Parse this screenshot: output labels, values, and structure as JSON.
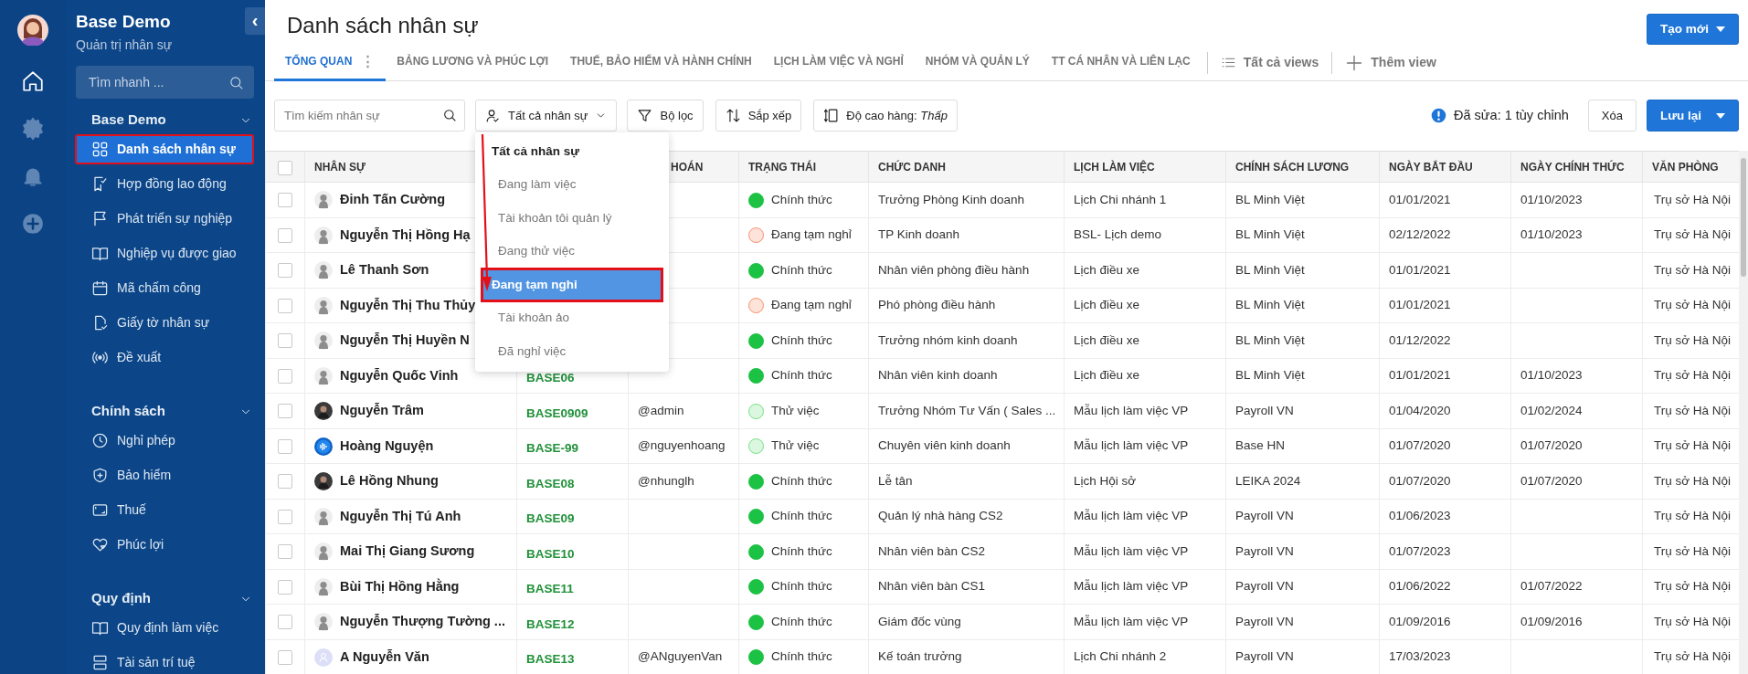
{
  "rail": {
    "items": [
      {
        "kind": "home",
        "selected": true
      },
      {
        "kind": "settings",
        "selected": false
      },
      {
        "kind": "bell",
        "selected": false
      },
      {
        "kind": "add",
        "selected": false
      }
    ]
  },
  "sidebar": {
    "collapse_icon": "‹",
    "title": "Base Demo",
    "subtitle": "Quản trị nhân sự",
    "search": {
      "placeholder": "Tìm nhanh ..."
    },
    "groups": [
      {
        "title": "Base Demo",
        "expanded": true,
        "items": [
          {
            "label": "Danh sách nhân sự",
            "selected": true
          },
          {
            "label": "Hợp đồng lao động",
            "selected": false
          },
          {
            "label": "Phát triển sự nghiệp",
            "selected": false
          },
          {
            "label": "Nghiệp vụ được giao",
            "selected": false
          },
          {
            "label": "Mã chấm công",
            "selected": false
          },
          {
            "label": "Giấy tờ nhân sự",
            "selected": false
          },
          {
            "label": "Đề xuất",
            "selected": false
          }
        ]
      },
      {
        "title": "Chính sách",
        "expanded": true,
        "items": [
          {
            "label": "Nghỉ phép",
            "selected": false
          },
          {
            "label": "Bảo hiểm",
            "selected": false
          },
          {
            "label": "Thuế",
            "selected": false
          },
          {
            "label": "Phúc lợi",
            "selected": false
          }
        ]
      },
      {
        "title": "Quy định",
        "expanded": true,
        "items": [
          {
            "label": "Quy định làm việc",
            "selected": false
          },
          {
            "label": "Tài sản trí tuệ",
            "selected": false
          }
        ]
      }
    ]
  },
  "page": {
    "title": "Danh sách nhân sự",
    "create_button": "Tạo mới"
  },
  "tabs": [
    {
      "label": "TỔNG QUAN",
      "selected": true,
      "menu": "⋮"
    },
    {
      "label": "BẢNG LƯƠNG VÀ PHÚC LỢI",
      "selected": false
    },
    {
      "label": "THUẾ, BẢO HIỂM VÀ HÀNH CHÍNH",
      "selected": false
    },
    {
      "label": "LỊCH LÀM VIỆC VÀ NGHỈ",
      "selected": false
    },
    {
      "label": "NHÓM VÀ QUẢN LÝ",
      "selected": false
    },
    {
      "label": "TT CÁ NHÂN VÀ LIÊN LẠC",
      "selected": false
    }
  ],
  "view_links": [
    {
      "kind": "list",
      "label": "Tất cả views"
    },
    {
      "kind": "add",
      "label": "Thêm view"
    }
  ],
  "toolbar": {
    "search": {
      "placeholder": "Tìm kiếm nhân sự"
    },
    "filter_button": "Tất cả nhân sự",
    "buttons": [
      {
        "kind": "filter",
        "label": "Bộ lọc"
      },
      {
        "kind": "sort",
        "label": "Sắp xếp"
      },
      {
        "kind": "height",
        "label": "Độ cao hàng: *Thấp*"
      }
    ],
    "notice": "Đã sửa: 1 tùy chỉnh",
    "clear_button": "Xóa",
    "save_button": "Lưu lại"
  },
  "filter_menu": {
    "header": "Tất cả nhân sự",
    "items": [
      {
        "label": "Đang làm việc",
        "selected": false
      },
      {
        "label": "Tài khoản tôi quản lý",
        "selected": false
      },
      {
        "label": "Đang thử việc",
        "selected": false
      },
      {
        "label": "Đang tạm nghỉ",
        "selected": true
      },
      {
        "label": "Tài khoản ảo",
        "selected": false
      },
      {
        "label": "Đã nghỉ việc",
        "selected": false
      }
    ]
  },
  "table": {
    "select_all": {
      "checked": false
    },
    "columns": [
      {
        "label": "NHÂN SỰ"
      },
      {},
      {
        "label": "HOÁN"
      },
      {
        "label": "TRẠNG THÁI"
      },
      {
        "label": "CHỨC DANH"
      },
      {
        "label": "LỊCH LÀM VIỆC"
      },
      {
        "label": "CHÍNH SÁCH LƯƠNG"
      },
      {
        "label": "NGÀY BẮT ĐẦU"
      },
      {
        "label": "NGÀY CHÍNH THỨC"
      },
      {
        "label": "VĂN PHÒNG"
      }
    ],
    "rows": [
      {
        "checked": false,
        "name": "Đinh Tấn Cường",
        "status": {
          "label": "Chính thức",
          "color": "#1cc244"
        },
        "title": "Trưởng Phòng Kinh doanh",
        "schedule": "Lịch Chi nhánh 1",
        "salary": "BL Minh Việt",
        "start": "01/01/2021",
        "official": "01/10/2023",
        "office": "Trụ sở Hà Nội"
      },
      {
        "checked": false,
        "name": "Nguyễn Thị Hồng Hạ",
        "status": {
          "label": "Đang tạm nghỉ",
          "color": "#fde3da"
        },
        "title": "TP Kinh doanh",
        "schedule": "BSL- Lịch demo",
        "salary": "BL Minh Việt",
        "start": "02/12/2022",
        "official": "01/10/2023",
        "office": "Trụ sở Hà Nội"
      },
      {
        "checked": false,
        "name": "Lê Thanh Sơn",
        "status": {
          "label": "Chính thức",
          "color": "#1cc244"
        },
        "title": "Nhân viên phòng điều hành",
        "schedule": "Lịch điều xe",
        "salary": "BL Minh Việt",
        "start": "01/01/2021",
        "office": "Trụ sở Hà Nội"
      },
      {
        "checked": false,
        "name": "Nguyễn Thị Thu Thủy",
        "status": {
          "label": "Đang tạm nghỉ",
          "color": "#fde3da"
        },
        "title": "Phó phòng điều hành",
        "schedule": "Lịch điều xe",
        "salary": "BL Minh Việt",
        "start": "01/01/2021",
        "office": "Trụ sở Hà Nội"
      },
      {
        "checked": false,
        "name": "Nguyễn Thị Huyền N",
        "status": {
          "label": "Chính thức",
          "color": "#1cc244"
        },
        "title": "Trưởng nhóm kinh doanh",
        "schedule": "Lịch điều xe",
        "salary": "BL Minh Việt",
        "start": "01/12/2022",
        "office": "Trụ sở Hà Nội"
      },
      {
        "checked": false,
        "name": "Nguyễn Quốc Vinh",
        "code": "BASE06",
        "status": {
          "label": "Chính thức",
          "color": "#1cc244"
        },
        "title": "Nhân viên kinh doanh",
        "schedule": "Lịch điều xe",
        "salary": "BL Minh Việt",
        "start": "01/01/2021",
        "official": "01/10/2023",
        "office": "Trụ sở Hà Nội"
      },
      {
        "checked": false,
        "name": "Nguyễn Trâm",
        "code": "BASE0909",
        "account": "@admin",
        "status": {
          "label": "Thử việc",
          "color": "#dcf7e0"
        },
        "title": "Trưởng Nhóm Tư Vấn ( Sales ...",
        "schedule": "Mẫu lịch làm việc VP",
        "salary": "Payroll VN",
        "start": "01/04/2020",
        "official": "01/02/2024",
        "office": "Trụ sở Hà Nội"
      },
      {
        "checked": false,
        "name": "Hoàng Nguyện",
        "code": "BASE-99",
        "account": "@nguyenhoang",
        "status": {
          "label": "Thử việc",
          "color": "#dcf7e0"
        },
        "title": "Chuyên viên kinh doanh",
        "schedule": "Mẫu lịch làm việc VP",
        "salary": "Base HN",
        "start": "01/07/2020",
        "official": "01/07/2020",
        "office": "Trụ sở Hà Nội"
      },
      {
        "checked": false,
        "name": "Lê Hồng Nhung",
        "code": "BASE08",
        "account": "@nhunglh",
        "status": {
          "label": "Chính thức",
          "color": "#1cc244"
        },
        "title": "Lễ tân",
        "schedule": "Lịch Hội sở",
        "salary": "LEIKA 2024",
        "start": "01/07/2020",
        "official": "01/07/2020",
        "office": "Trụ sở Hà Nội"
      },
      {
        "checked": false,
        "name": "Nguyễn Thị Tú Anh",
        "code": "BASE09",
        "status": {
          "label": "Chính thức",
          "color": "#1cc244"
        },
        "title": "Quản lý nhà hàng CS2",
        "schedule": "Mẫu lịch làm việc VP",
        "salary": "Payroll VN",
        "start": "01/06/2023",
        "office": "Trụ sở Hà Nội"
      },
      {
        "checked": false,
        "name": "Mai Thị Giang Sương",
        "code": "BASE10",
        "status": {
          "label": "Chính thức",
          "color": "#1cc244"
        },
        "title": "Nhân viên bàn CS2",
        "schedule": "Mẫu lịch làm việc VP",
        "salary": "Payroll VN",
        "start": "01/07/2023",
        "office": "Trụ sở Hà Nội"
      },
      {
        "checked": false,
        "name": "Bùi Thị Hồng Hằng",
        "code": "BASE11",
        "status": {
          "label": "Chính thức",
          "color": "#1cc244"
        },
        "title": "Nhân viên bàn CS1",
        "schedule": "Mẫu lịch làm việc VP",
        "salary": "Payroll VN",
        "start": "01/06/2022",
        "official": "01/07/2022",
        "office": "Trụ sở Hà Nội"
      },
      {
        "checked": false,
        "name": "Nguyễn Thượng Tường ...",
        "code": "BASE12",
        "status": {
          "label": "Chính thức",
          "color": "#1cc244"
        },
        "title": "Giám đốc vùng",
        "schedule": "Mẫu lịch làm việc VP",
        "salary": "Payroll VN",
        "start": "01/09/2016",
        "official": "01/09/2016",
        "office": "Trụ sở Hà Nội"
      },
      {
        "checked": false,
        "name": "A Nguyễn Văn",
        "code": "BASE13",
        "account": "@ANguyenVan",
        "status": {
          "label": "Chính thức",
          "color": "#1cc244"
        },
        "title": "Kế toán trưởng",
        "schedule": "Lịch Chi nhánh 2",
        "salary": "Payroll VN",
        "start": "17/03/2023",
        "office": "Trụ sở Hà Nội"
      }
    ]
  }
}
